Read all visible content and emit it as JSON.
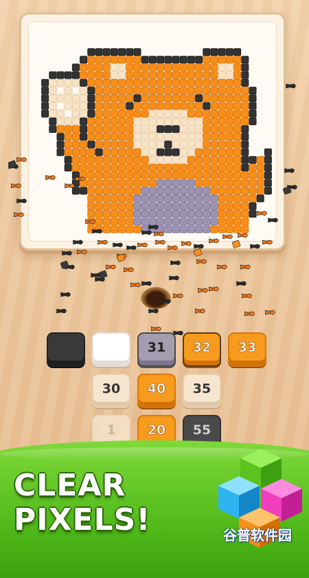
{
  "palette": {
    "orange": "#f78e1a",
    "black": "#333333",
    "cream": "#f8e3c6",
    "grey": "#9c93b3",
    "white": "#fffaf3",
    "brand_green": "#5cc21e"
  },
  "board": {
    "title": "",
    "pixel_rows": [
      "......BBBBBBB........BBBBB....",
      ".....BOOOOOOOBBBBBBBBOOOOOB...",
      "....BOOOOCCOOOOOOOOOOOOCCOB...",
      ".BBBBOOOOCCOOOOOOOOOOOOCCOB...",
      "BCCCCBOOOOOOOOOOOOOOOOOOOOB...",
      "BCWCWCBOOOOOOOOOOOOOOOOOOOOB..",
      "BCCCCCBOOOOOBOOOOOOOBOOOOOOB..",
      "BCWCCCBOOOOBOOOOOOOOOBOOOOOB..",
      "BCCWCCBOOOOOOOCCCCCOOOOOOOOB..",
      ".BCCCBOOOOOOCCCCCCCCCOOOOOOB..",
      ".BOOOBOOOOOOCCCBBBCCCOOOOOB...",
      "..BOOBOOOOOOCCCCCCCCCOOOOOB...",
      "..BOOOBOOOOOCCCCBCCCCOOOOOB...",
      "..BOOOOBOOOOOCCBBBCCOOOOOOB..B",
      "...BOOOOOOOOOOCCCCCOOOOOOOBBOB",
      "...BOOOOOOOOOOOOOOOOOOOOOOBOOB",
      "....BOOOOOOOOOOOOOOOOOOOOOOOOB",
      "....BOOOOOOOOOOGGGGGOOOOOOOOOB",
      "....BBOOOOOOOGGGGGGGGGOOOOOOOB",
      "......OOOOOOGGGGGGGGGGGOOOOOB.",
      "......OOOOOOGGGGGGGGGGGOOOOB..",
      "......OOOOOOGGGGGGGGGGGOOOOB..",
      "......OOOOOOGGGGGGGGGGGOOOO...",
      "......OOOOOOOGGGGGGGGGOOOOO...",
      "..............................",
      ".............................."
    ]
  },
  "tiles": [
    {
      "row": 1,
      "col": 1,
      "style": "t-black",
      "label": ""
    },
    {
      "row": 1,
      "col": 2,
      "style": "t-white",
      "label": ""
    },
    {
      "row": 1,
      "col": 3,
      "style": "t-grey",
      "label": "31"
    },
    {
      "row": 1,
      "col": 4,
      "style": "t-orange-ol",
      "label": "32"
    },
    {
      "row": 1,
      "col": 5,
      "style": "t-orange",
      "label": "33"
    },
    {
      "row": 2,
      "col": 2,
      "style": "t-cream",
      "label": "30"
    },
    {
      "row": 2,
      "col": 3,
      "style": "t-orange",
      "label": "40"
    },
    {
      "row": 2,
      "col": 4,
      "style": "t-cream",
      "label": "35"
    },
    {
      "row": 3,
      "col": 2,
      "style": "t-cream-faded",
      "label": "1"
    },
    {
      "row": 3,
      "col": 3,
      "style": "t-orange",
      "label": "20"
    },
    {
      "row": 3,
      "col": 4,
      "style": "t-darkgrey",
      "label": "55"
    }
  ],
  "headline": {
    "line1": "CLEAR",
    "line2": "PIXELS!"
  },
  "logo_text": "谷普软件园"
}
